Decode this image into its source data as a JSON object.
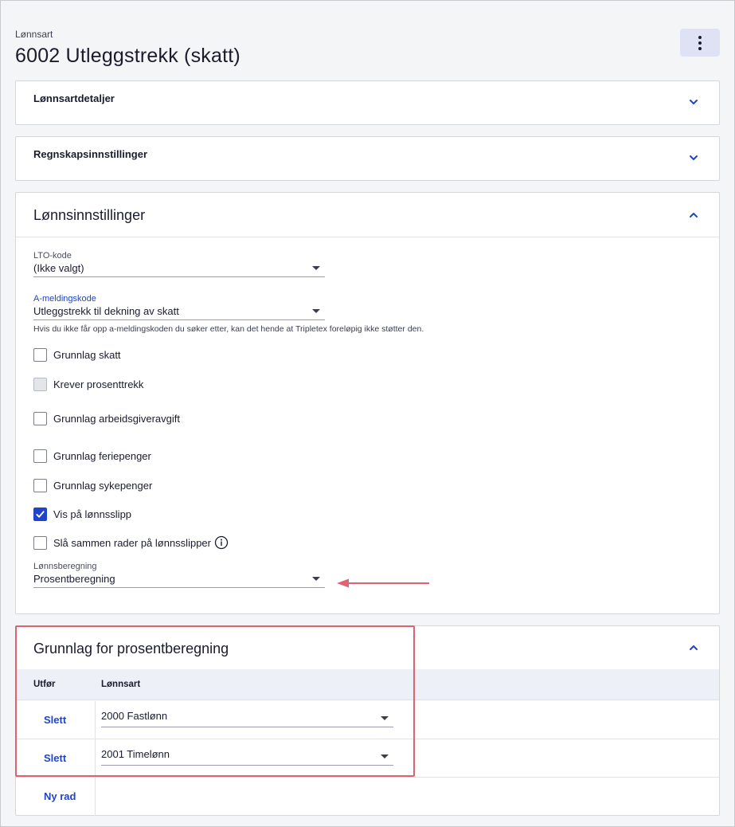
{
  "header": {
    "breadcrumb": "Lønnsart",
    "title": "6002 Utleggstrekk (skatt)",
    "menu_icon": "kebab-menu-icon"
  },
  "sections": {
    "details": {
      "title": "Lønnsartdetaljer",
      "icon": "chevron-down-icon"
    },
    "accounting": {
      "title": "Regnskapsinnstillinger",
      "icon": "chevron-down-icon"
    },
    "payroll": {
      "title": "Lønnsinnstillinger",
      "icon": "chevron-up-icon",
      "lto": {
        "label": "LTO-kode",
        "value": "(Ikke valgt)"
      },
      "amelding": {
        "label": "A-meldingskode",
        "value": "Utleggstrekk til dekning av skatt",
        "help": "Hvis du ikke får opp a-meldingskoden du søker etter, kan det hende at Tripletex foreløpig ikke støtter den."
      },
      "checkboxes": [
        {
          "label": "Grunnlag skatt",
          "checked": false,
          "disabled": false
        },
        {
          "label": "Krever prosenttrekk",
          "checked": false,
          "disabled": true
        },
        {
          "label": "Grunnlag arbeidsgiveravgift",
          "checked": false,
          "disabled": false
        },
        {
          "label": "Grunnlag feriepenger",
          "checked": false,
          "disabled": false
        },
        {
          "label": "Grunnlag sykepenger",
          "checked": false,
          "disabled": false
        },
        {
          "label": "Vis på lønnsslipp",
          "checked": true,
          "disabled": false
        },
        {
          "label": "Slå sammen rader på lønnsslipper",
          "checked": false,
          "disabled": false
        }
      ],
      "calc": {
        "label": "Lønnsberegning",
        "value": "Prosentberegning"
      }
    },
    "percent_basis": {
      "title": "Grunnlag for prosentberegning",
      "icon": "chevron-up-icon",
      "columns": {
        "action": "Utfør",
        "wage_type": "Lønnsart"
      },
      "rows": [
        {
          "action": "Slett",
          "value": "2000 Fastlønn"
        },
        {
          "action": "Slett",
          "value": "2001 Timelønn"
        }
      ],
      "new_row": "Ny rad"
    }
  },
  "colors": {
    "accent": "#1f44c9",
    "highlight": "#e0626f"
  }
}
